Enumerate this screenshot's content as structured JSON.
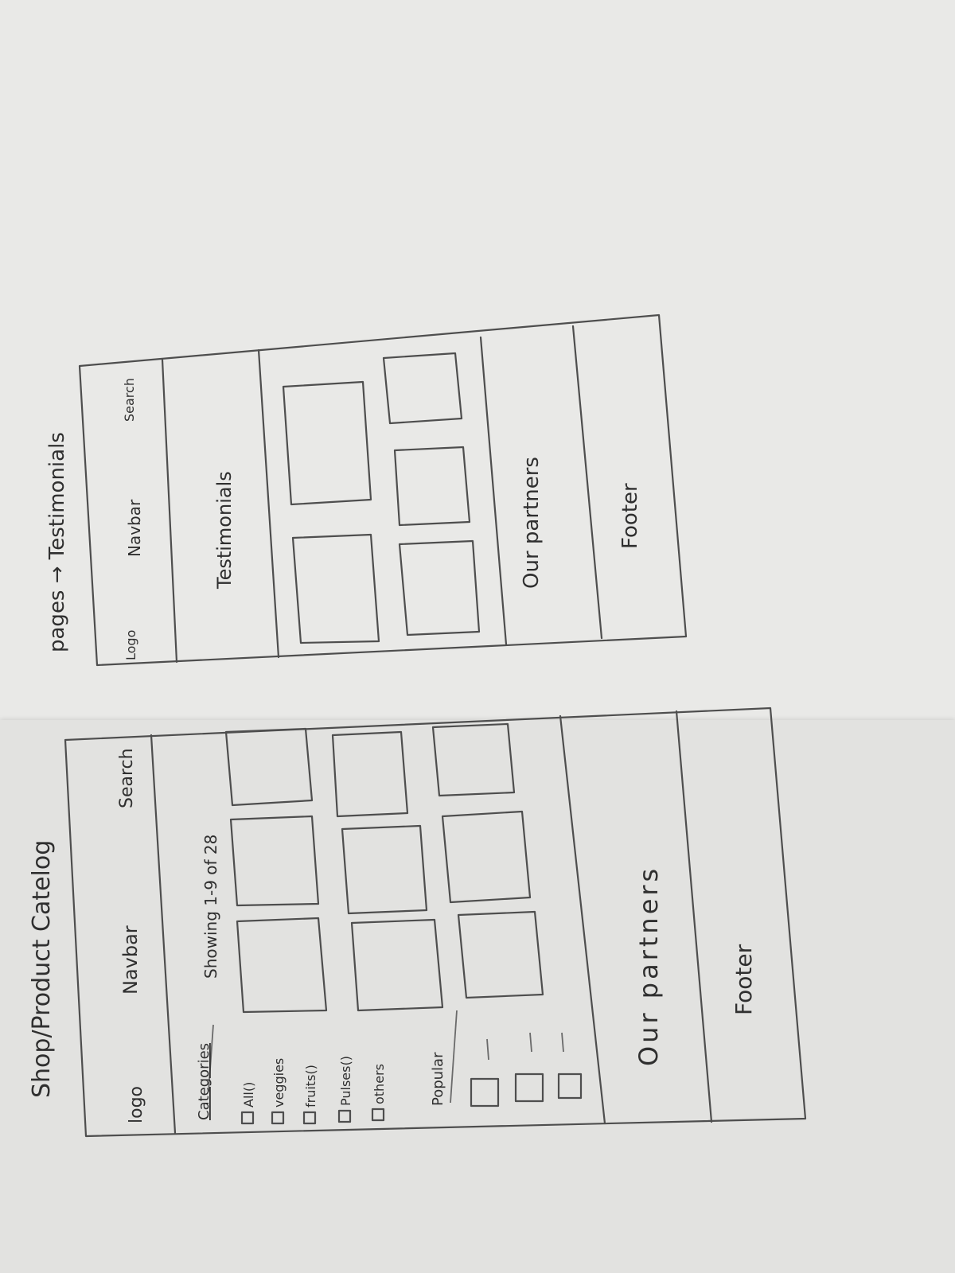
{
  "wireframe_1": {
    "title": "Shop/Product Catelog",
    "header": {
      "logo": "logo",
      "nav": "Navbar",
      "search": "Search"
    },
    "sidebar": {
      "categories_title": "Categories",
      "categories": [
        "All()",
        "veggies",
        "fruits()",
        "Pulses()",
        "others"
      ],
      "popular_title": "Popular"
    },
    "main": {
      "showing": "Showing 1-9 of 28",
      "product_count": 9
    },
    "partners": "Our partners",
    "footer": "Footer"
  },
  "wireframe_2": {
    "title": "pages → Testimonials",
    "header": {
      "logo": "Logo",
      "nav": "Navbar",
      "search": "Search"
    },
    "testimonials_title": "Testimonials",
    "testimonial_cards": 5,
    "partners": "Our partners",
    "footer": "Footer"
  }
}
